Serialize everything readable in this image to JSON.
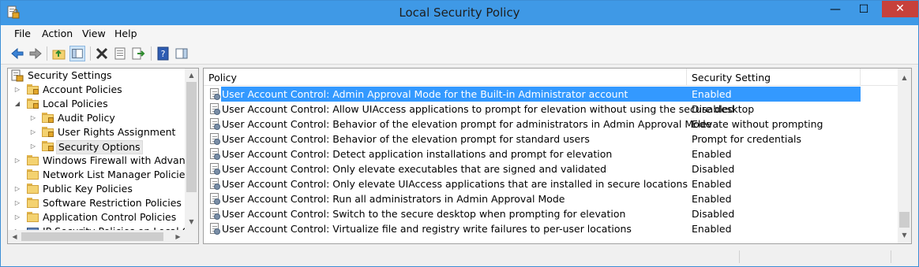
{
  "window": {
    "title": "Local Security Policy",
    "minimize_glyph": "—",
    "maximize_glyph": "☐",
    "close_glyph": "✕"
  },
  "menu": [
    "File",
    "Action",
    "View",
    "Help"
  ],
  "toolbar": {
    "buttons": [
      "back-icon",
      "forward-icon",
      "up-folder-icon",
      "show-hide-tree-icon",
      "delete-icon",
      "properties-icon",
      "export-list-icon",
      "help-icon",
      "show-action-pane-icon"
    ]
  },
  "tree": {
    "root": "Security Settings",
    "items": [
      {
        "label": "Account Policies",
        "level": 1,
        "expander": "▷"
      },
      {
        "label": "Local Policies",
        "level": 1,
        "expander": "◢"
      },
      {
        "label": "Audit Policy",
        "level": 2,
        "expander": "▷"
      },
      {
        "label": "User Rights Assignment",
        "level": 2,
        "expander": "▷"
      },
      {
        "label": "Security Options",
        "level": 2,
        "expander": "▷",
        "selected": true
      },
      {
        "label": "Windows Firewall with Advanced S",
        "level": 1,
        "expander": "▷"
      },
      {
        "label": "Network List Manager Policies",
        "level": 1,
        "expander": ""
      },
      {
        "label": "Public Key Policies",
        "level": 1,
        "expander": "▷"
      },
      {
        "label": "Software Restriction Policies",
        "level": 1,
        "expander": "▷"
      },
      {
        "label": "Application Control Policies",
        "level": 1,
        "expander": "▷"
      },
      {
        "label": "IP Security Policies on Local C",
        "level": 1,
        "expander": "▷"
      }
    ]
  },
  "list": {
    "columns": [
      "Policy",
      "Security Setting"
    ],
    "sort_glyph": "^",
    "rows": [
      {
        "policy": "User Account Control: Admin Approval Mode for the Built-in Administrator account",
        "setting": "Enabled",
        "selected": true
      },
      {
        "policy": "User Account Control: Allow UIAccess applications to prompt for elevation without using the secure desktop",
        "setting": "Disabled"
      },
      {
        "policy": "User Account Control: Behavior of the elevation prompt for administrators in Admin Approval Mode",
        "setting": "Elevate without prompting"
      },
      {
        "policy": "User Account Control: Behavior of the elevation prompt for standard users",
        "setting": "Prompt for credentials"
      },
      {
        "policy": "User Account Control: Detect application installations and prompt for elevation",
        "setting": "Enabled"
      },
      {
        "policy": "User Account Control: Only elevate executables that are signed and validated",
        "setting": "Disabled"
      },
      {
        "policy": "User Account Control: Only elevate UIAccess applications that are installed in secure locations",
        "setting": "Enabled"
      },
      {
        "policy": "User Account Control: Run all administrators in Admin Approval Mode",
        "setting": "Enabled"
      },
      {
        "policy": "User Account Control: Switch to the secure desktop when prompting for elevation",
        "setting": "Disabled"
      },
      {
        "policy": "User Account Control: Virtualize file and registry write failures to per-user locations",
        "setting": "Enabled"
      }
    ]
  },
  "scroll": {
    "up": "▲",
    "down": "▼"
  }
}
